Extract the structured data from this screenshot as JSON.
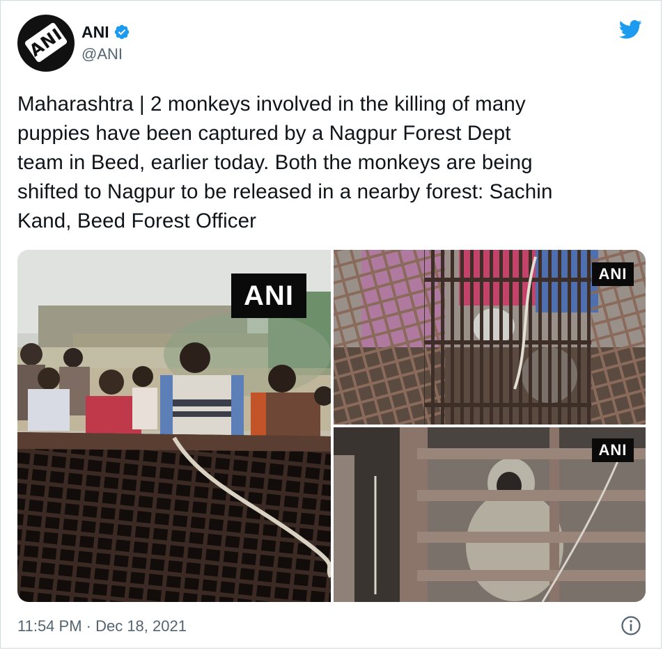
{
  "author": {
    "display_name": "ANI",
    "handle": "@ANI",
    "avatar_text": "ANI",
    "verified": true
  },
  "tweet": {
    "text": "Maharashtra | 2 monkeys involved in the killing of many\npuppies have been captured by a Nagpur Forest Dept\nteam in Beed, earlier today. Both the monkeys are being\nshifted to Nagpur to be released in a nearby forest: Sachin\nKand, Beed Forest Officer"
  },
  "media": {
    "watermarks": [
      "ANI",
      "ANI",
      "ANI"
    ]
  },
  "footer": {
    "timestamp": "11:54 PM · Dec 18, 2021"
  },
  "icons": {
    "brand": "twitter-bird-icon",
    "verified": "verified-badge-icon",
    "info": "info-icon"
  },
  "colors": {
    "twitter_blue": "#1d9bf0",
    "secondary_text": "#536471",
    "border": "#cfd9de"
  }
}
